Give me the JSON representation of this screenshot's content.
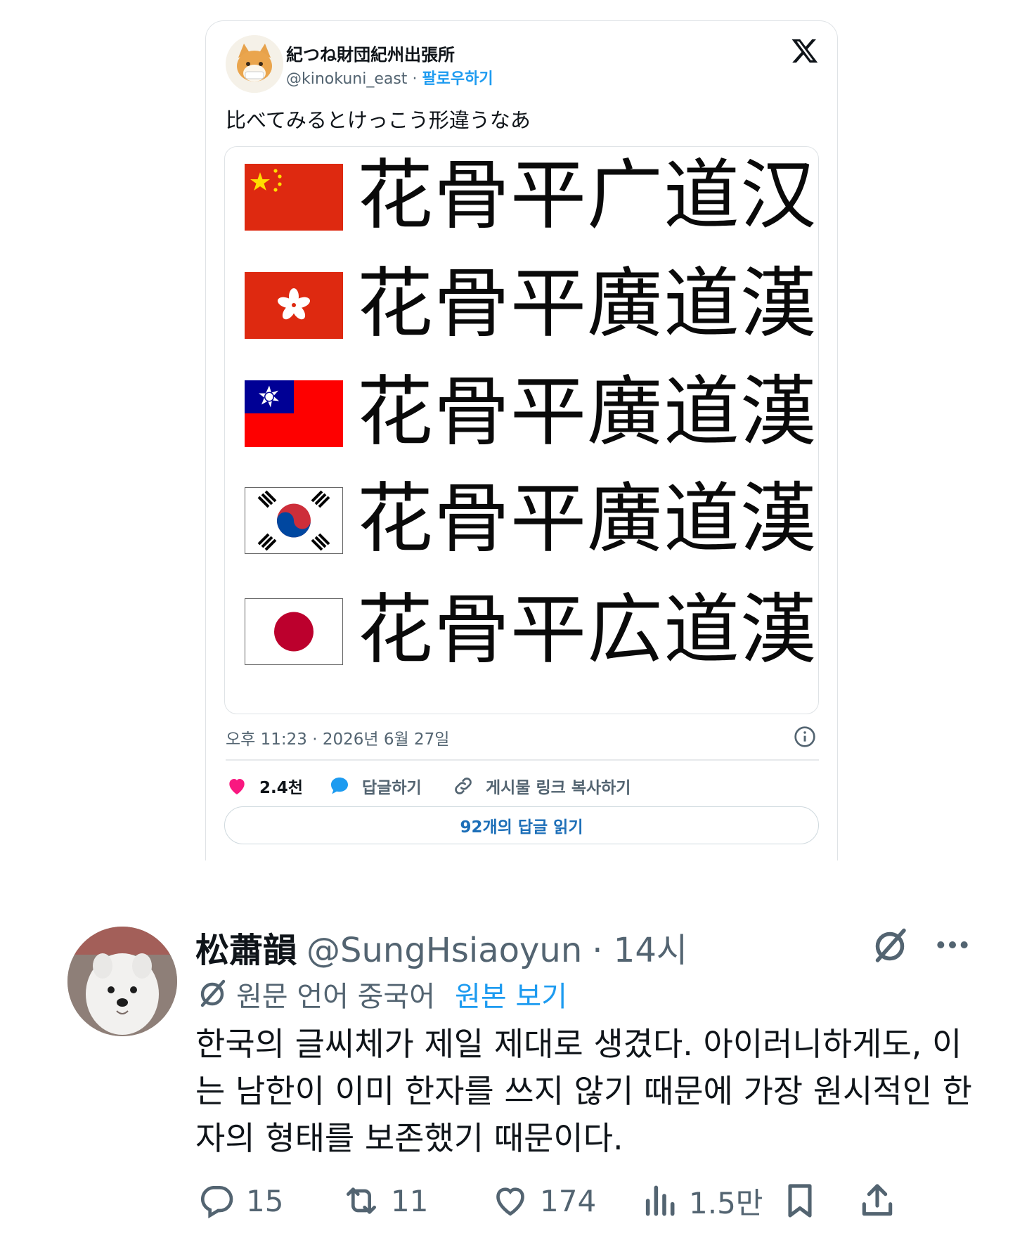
{
  "embed": {
    "author_name": "紀つね財団紀州出張所",
    "handle": "@kinokuni_east",
    "separator": "·",
    "follow_label": "팔로우하기",
    "text": "比べてみるとけっこう形違うなあ",
    "image_rows": [
      {
        "flag": "china-flag",
        "chars": "花骨平广道汉"
      },
      {
        "flag": "hong-kong-flag",
        "chars": "花骨平廣道漢"
      },
      {
        "flag": "taiwan-flag",
        "chars": "花骨平廣道漢"
      },
      {
        "flag": "south-korea-flag",
        "chars": "花骨平廣道漢"
      },
      {
        "flag": "japan-flag",
        "chars": "花骨平広道漢"
      }
    ],
    "date": "오후 11:23 · 2026년 6월 27일",
    "like_count": "2.4천",
    "reply_label": "답글하기",
    "copy_link_label": "게시물 링크 복사하기",
    "read_replies_label": "92개의 답글 읽기",
    "colors": {
      "like": "#f91880",
      "reply": "#1d9bf0",
      "link": "#1d6fb8"
    }
  },
  "reply": {
    "name": "松蕭韻",
    "handle": "@SungHsiaoyun",
    "time": "· 14시",
    "translated_from": "원문 언어 중국어",
    "show_original_label": "원본 보기",
    "body": "한국의 글씨체가 제일 제대로 생겼다. 아이러니하게도, 이는 남한이 이미 한자를 쓰지 않기 때문에 가장 원시적인 한자의 형태를 보존했기 때문이다.",
    "stats": {
      "replies": "15",
      "retweets": "11",
      "likes": "174",
      "views": "1.5만"
    },
    "icons": [
      "grok-icon",
      "more-icon",
      "reply-icon",
      "retweet-icon",
      "like-icon",
      "views-icon",
      "bookmark-icon",
      "share-icon"
    ]
  }
}
